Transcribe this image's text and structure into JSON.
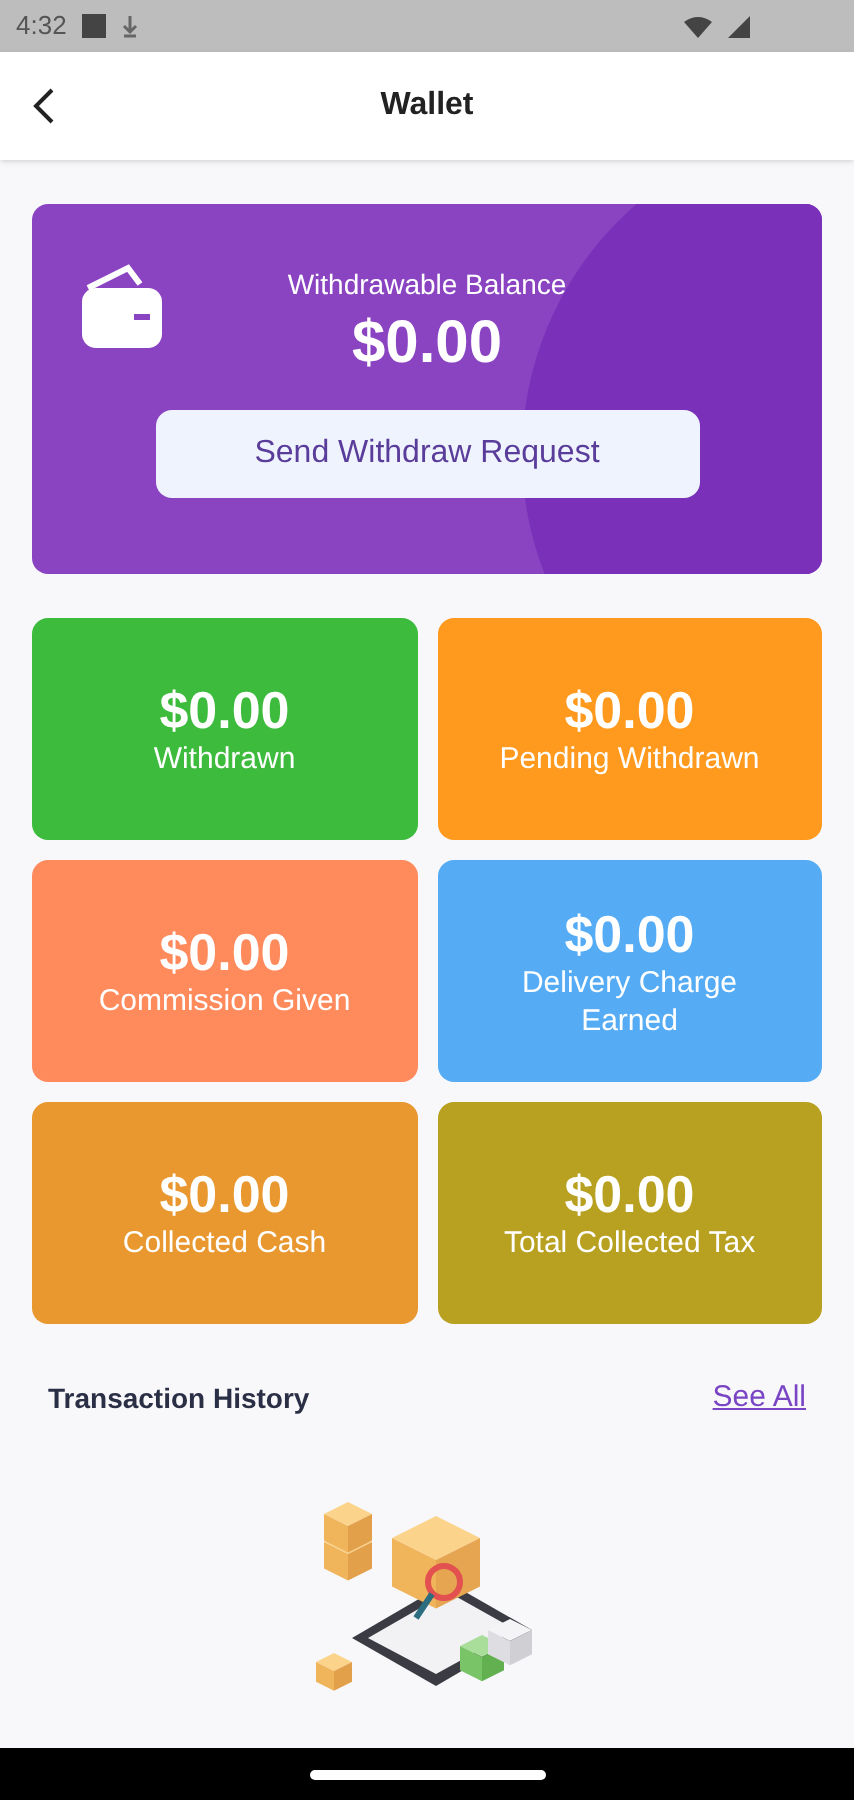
{
  "status_bar": {
    "time": "4:32"
  },
  "header": {
    "title": "Wallet"
  },
  "balance": {
    "label": "Withdrawable Balance",
    "amount": "$0.00",
    "button": "Send Withdraw Request"
  },
  "stats": [
    {
      "amount": "$0.00",
      "label": "Withdrawn",
      "color": "#3dbb3d"
    },
    {
      "amount": "$0.00",
      "label": "Pending Withdrawn",
      "color": "#ff9a1e"
    },
    {
      "amount": "$0.00",
      "label": "Commission Given",
      "color": "#ff8a5c"
    },
    {
      "amount": "$0.00",
      "label": "Delivery Charge Earned",
      "color": "#55acf5"
    },
    {
      "amount": "$0.00",
      "label": "Collected Cash",
      "color": "#e8982f"
    },
    {
      "amount": "$0.00",
      "label": "Total Collected Tax",
      "color": "#b8a020"
    }
  ],
  "history": {
    "title": "Transaction History",
    "link": "See All"
  }
}
